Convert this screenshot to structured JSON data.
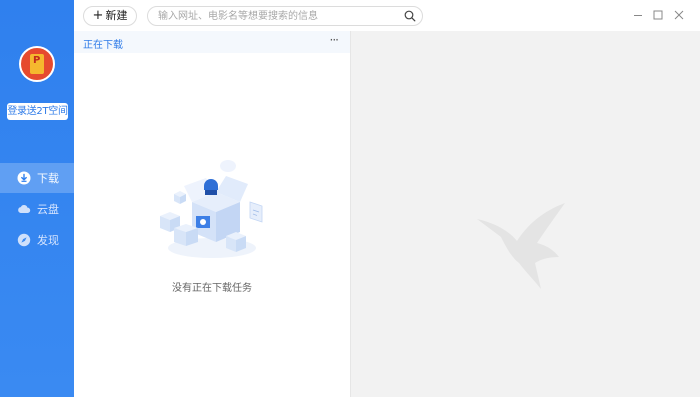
{
  "sidebar": {
    "login_label": "登录送2T空间",
    "items": [
      {
        "label": "下载",
        "icon": "download-icon",
        "active": true
      },
      {
        "label": "云盘",
        "icon": "cloud-icon",
        "active": false
      },
      {
        "label": "发现",
        "icon": "compass-icon",
        "active": false
      }
    ]
  },
  "toolbar": {
    "new_label": "新建",
    "search_placeholder": "输入网址、电影名等想要搜索的信息"
  },
  "downloads": {
    "tab_title": "正在下载",
    "more_label": "···",
    "empty_text": "没有正在下载任务"
  },
  "colors": {
    "sidebar": "#2f80ee",
    "accent": "#2f7be8",
    "pane_bg": "#f2f2f2"
  }
}
